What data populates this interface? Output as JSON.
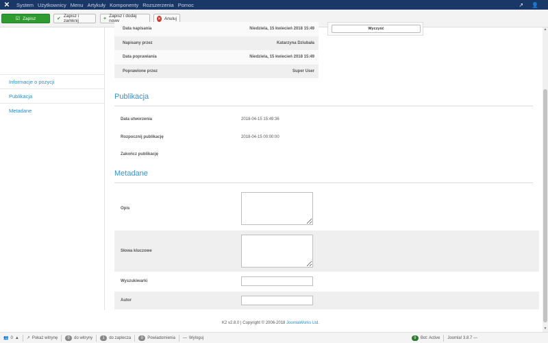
{
  "topbar": {
    "menu": [
      "System",
      "Użytkownicy",
      "Menu",
      "Artykuły",
      "Komponenty",
      "Rozszerzenia",
      "Pomoc"
    ]
  },
  "toolbar": {
    "save_label": "Zapisz",
    "save_close_label": "Zapisz i zamknij",
    "save_new_label": "Zapisz i dodaj nowy",
    "cancel_label": "Anuluj"
  },
  "sidebar": {
    "items": [
      {
        "label": "Informacje o pozycji"
      },
      {
        "label": "Publikacja"
      },
      {
        "label": "Metadane"
      }
    ]
  },
  "info": {
    "rows": [
      {
        "label": "Data napisania",
        "value": "Niedziela, 15 kwiecień 2018 15:49"
      },
      {
        "label": "Napisany przez",
        "value": "Katarzyna Dziubała"
      },
      {
        "label": "Data poprawiania",
        "value": "Niedziela, 15 kwiecień 2018 15:49"
      },
      {
        "label": "Poprawione przez",
        "value": "Super User"
      }
    ],
    "clear_label": "Wyczyść"
  },
  "publikacja": {
    "title": "Publikacja",
    "rows": [
      {
        "label": "Data utworzenia",
        "value": "2018-04-15 15:49:36"
      },
      {
        "label": "Rozpocznij publikację",
        "value": "2018-04-15 00:00:00"
      },
      {
        "label": "Zakończ publikację",
        "value": ""
      }
    ]
  },
  "metadane": {
    "title": "Metadane",
    "desc_label": "Opis",
    "keywords_label": "Słowa kluczowe",
    "robots_label": "Wyszukiwarki",
    "author_label": "Autor",
    "desc_value": "",
    "keywords_value": "",
    "robots_value": "",
    "author_value": ""
  },
  "footer": {
    "prefix": "K2 v2.8.0 | Copyright © 2006-2018 ",
    "link": "JoomlaWorks Ltd."
  },
  "statusbar": {
    "users_count": "0",
    "view_site": "Pokaż witrynę",
    "visitors_count": "0",
    "visitors_label": "do witryny",
    "admins_count": "1",
    "admins_label": "do zaplecza",
    "messages_count": "0",
    "messages_label": "Powiadomienia",
    "logout_label": "Wyloguj",
    "errors_count": "9",
    "errors_label": "Bot: Active",
    "version": "Joomla! 3.8.7 —"
  },
  "colors": {
    "topbar": "#1a3867",
    "accent": "#3a8fc6",
    "save": "#2f9a2f",
    "cancel": "#c0392b"
  }
}
